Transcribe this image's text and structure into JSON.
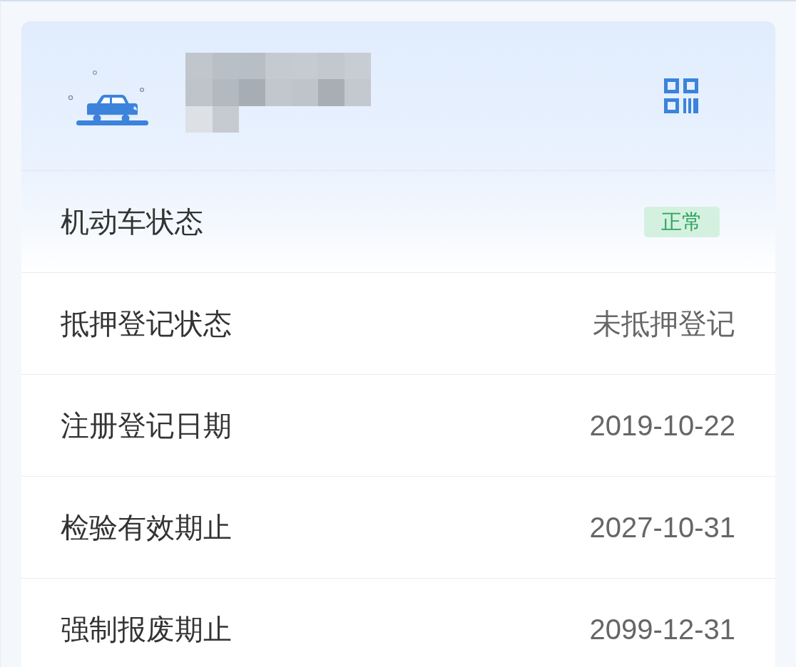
{
  "vehicle_info": {
    "rows": [
      {
        "label": "机动车状态",
        "value": "正常",
        "kind": "badge"
      },
      {
        "label": "抵押登记状态",
        "value": "未抵押登记",
        "kind": "text"
      },
      {
        "label": "注册登记日期",
        "value": "2019-10-22",
        "kind": "text"
      },
      {
        "label": "检验有效期止",
        "value": "2027-10-31",
        "kind": "text"
      },
      {
        "label": "强制报废期止",
        "value": "2099-12-31",
        "kind": "text"
      }
    ]
  }
}
